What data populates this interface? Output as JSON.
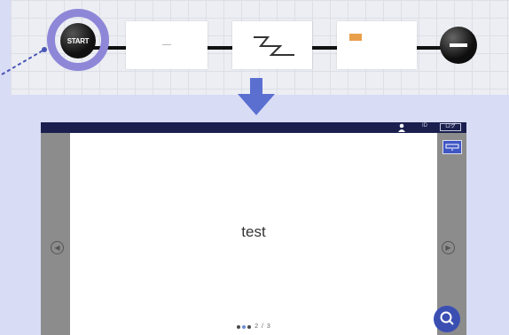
{
  "flow": {
    "start_label": "START",
    "accent": "#8e87d8",
    "nodes": [
      {
        "kind": "text-dash"
      },
      {
        "kind": "zigzag"
      },
      {
        "kind": "orange-block"
      }
    ]
  },
  "device": {
    "topbar": {
      "mini_text": "ID",
      "button_label": "ログ"
    },
    "slide": {
      "text": "test",
      "page": "2 / 3"
    }
  },
  "colors": {
    "topbar": "#1a1f4e",
    "slide_bg": "#ffffff",
    "side_gray": "#8c8c8c",
    "button_blue": "#3b4fb3",
    "arrow_blue": "#5b6fd1",
    "orange": "#e8a04a"
  }
}
